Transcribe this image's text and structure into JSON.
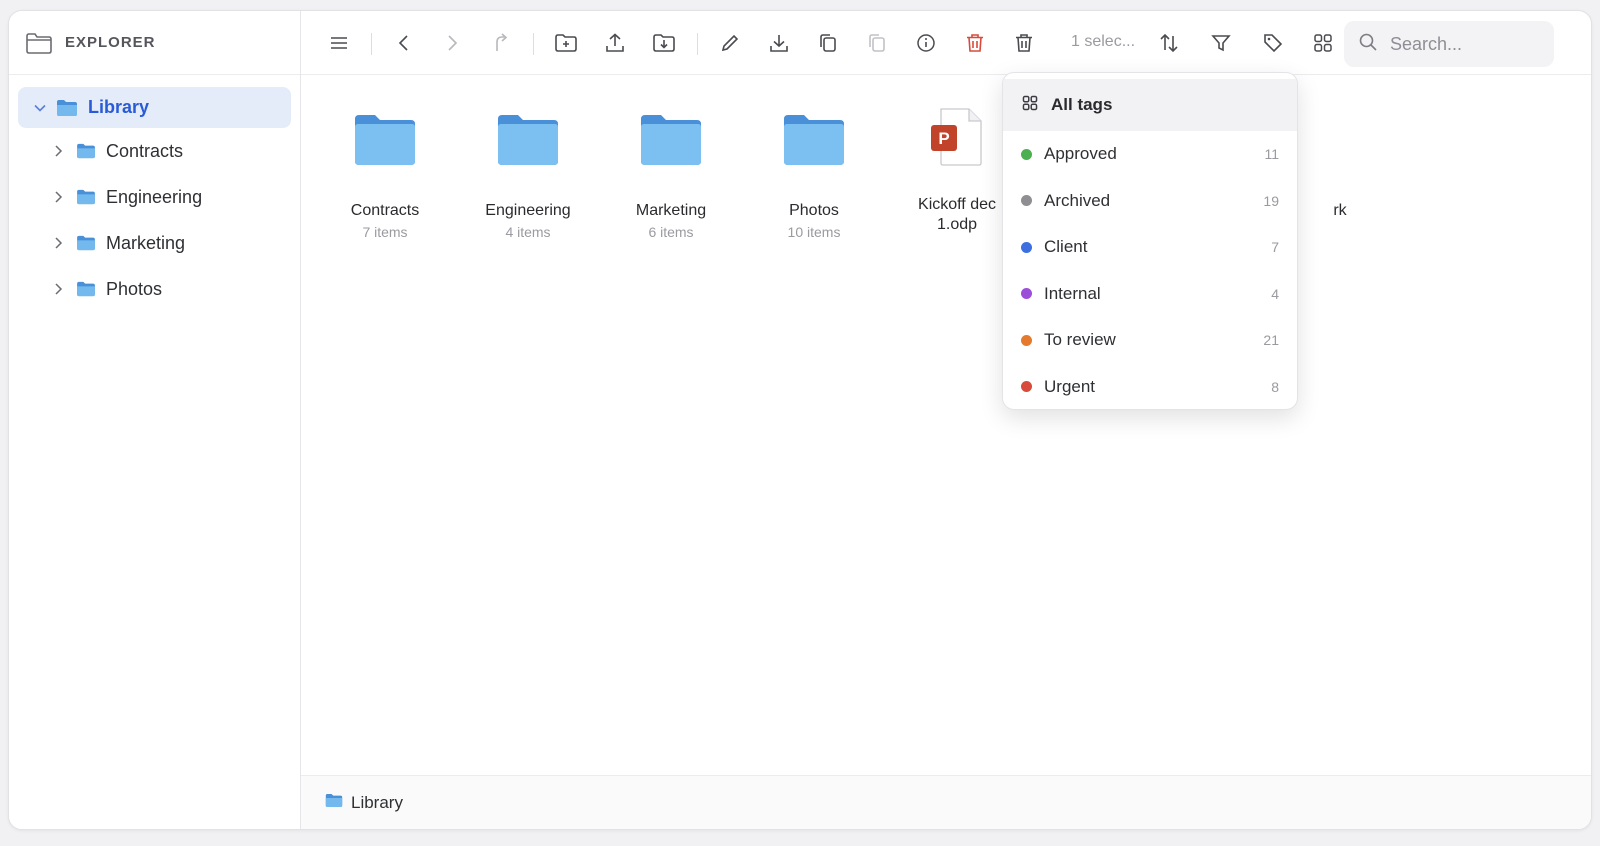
{
  "sidebar": {
    "title": "EXPLORER",
    "root": {
      "label": "Library"
    },
    "items": [
      {
        "label": "Contracts"
      },
      {
        "label": "Engineering"
      },
      {
        "label": "Marketing"
      },
      {
        "label": "Photos"
      }
    ]
  },
  "toolbar": {
    "icons": [
      "menu-icon",
      "back-icon",
      "forward-icon",
      "up-icon",
      "new-folder-icon",
      "upload-icon",
      "import-icon",
      "rename-icon",
      "download-icon",
      "copy-icon",
      "paste-icon",
      "info-icon",
      "delete-icon",
      "trash-icon",
      "sort-icon",
      "filter-icon",
      "tag-icon",
      "grid-view-icon"
    ],
    "selection": "1 selec...",
    "search_placeholder": "Search..."
  },
  "content": {
    "items": [
      {
        "name": "Contracts",
        "meta": "7 items"
      },
      {
        "name": "Engineering",
        "meta": "4 items"
      },
      {
        "name": "Marketing",
        "meta": "6 items"
      },
      {
        "name": "Photos",
        "meta": "10 items"
      },
      {
        "name_line1": "Kickoff dec",
        "name_line2": "1.odp"
      },
      {
        "name_partial": "rk"
      }
    ]
  },
  "footer": {
    "path": "Library"
  },
  "tags_menu": {
    "all_label": "All tags",
    "items": [
      {
        "label": "Approved",
        "count": "11",
        "color": "#4caf50"
      },
      {
        "label": "Archived",
        "count": "19",
        "color": "#8e8e93"
      },
      {
        "label": "Client",
        "count": "7",
        "color": "#3d6fe0"
      },
      {
        "label": "Internal",
        "count": "4",
        "color": "#9b4fd8"
      },
      {
        "label": "To review",
        "count": "21",
        "color": "#e57a2c"
      },
      {
        "label": "Urgent",
        "count": "8",
        "color": "#d84a3c"
      }
    ]
  },
  "colors": {
    "accent": "#2a5bd7",
    "folder": "#74b9ee",
    "danger": "#d84a3c"
  }
}
